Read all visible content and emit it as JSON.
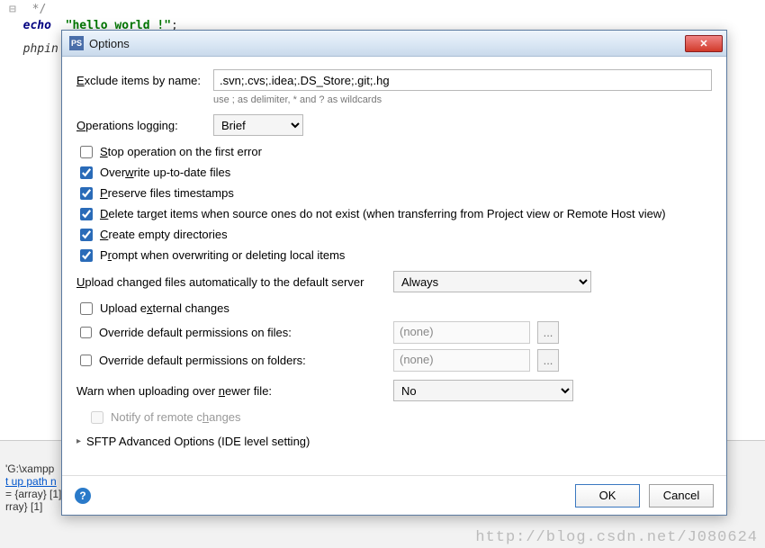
{
  "code": {
    "line0": "  */",
    "echo_kw": "echo",
    "echo_str": "\"hello world !\"",
    "echo_semi": ";",
    "phpin": "phpin"
  },
  "bottom": {
    "path": "'G:\\xampp",
    "link": "t up path n",
    "arrvar": " = {array}",
    "arrclose": "rray} [1]",
    "brcount": "[1]"
  },
  "dialog": {
    "title": "Options",
    "exclude_label": "Exclude items by name:",
    "exclude_value": ".svn;.cvs;.idea;.DS_Store;.git;.hg",
    "exclude_hint": "use ; as delimiter, * and ? as wildcards",
    "oplog_label": "Operations logging:",
    "oplog_value": "Brief",
    "cb_stop": "Stop operation on the first error",
    "cb_overwrite": "Overwrite up-to-date files",
    "cb_preserve": "Preserve files timestamps",
    "cb_delete": "Delete target items when source ones do not exist (when transferring from Project view or Remote Host view)",
    "cb_create": "Create empty directories",
    "cb_prompt": "Prompt when overwriting or deleting local items",
    "upload_label": "Upload changed files automatically to the default server",
    "upload_value": "Always",
    "cb_external": "Upload external changes",
    "cb_permfile": "Override default permissions on files:",
    "cb_permfolder": "Override default permissions on folders:",
    "perm_none": "(none)",
    "perm_btn": "...",
    "warn_label": "Warn when uploading over newer file:",
    "warn_value": "No",
    "cb_notify": "Notify of remote changes",
    "advanced": "SFTP Advanced Options (IDE level setting)",
    "ok": "OK",
    "cancel": "Cancel"
  },
  "watermark": "http://blog.csdn.net/J080624"
}
